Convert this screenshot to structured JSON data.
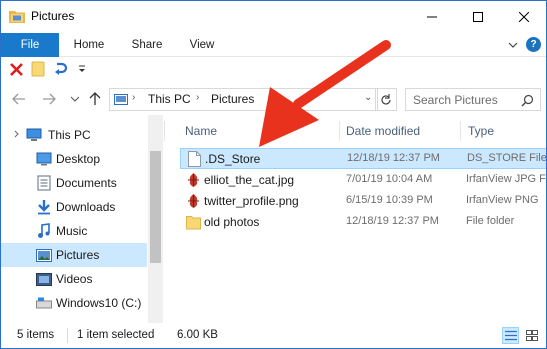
{
  "window": {
    "title": "Pictures"
  },
  "ribbon": {
    "tabs": [
      "File",
      "Home",
      "Share",
      "View"
    ],
    "accent": "#1979ca"
  },
  "address": {
    "crumbs": [
      "This PC",
      "Pictures"
    ]
  },
  "search": {
    "placeholder": "Search Pictures"
  },
  "nav": {
    "items": [
      {
        "label": "This PC",
        "icon": "computer-icon"
      },
      {
        "label": "Desktop",
        "icon": "desktop-icon"
      },
      {
        "label": "Documents",
        "icon": "documents-icon"
      },
      {
        "label": "Downloads",
        "icon": "downloads-icon"
      },
      {
        "label": "Music",
        "icon": "music-icon"
      },
      {
        "label": "Pictures",
        "icon": "pictures-icon",
        "selected": true
      },
      {
        "label": "Videos",
        "icon": "videos-icon"
      },
      {
        "label": "Windows10 (C:)",
        "icon": "drive-icon"
      }
    ]
  },
  "files": {
    "columns": [
      "Name",
      "Date modified",
      "Type"
    ],
    "rows": [
      {
        "name": ".DS_Store",
        "date": "12/18/19 12:37 PM",
        "type": "DS_STORE File",
        "icon": "blank-file-icon",
        "selected": true
      },
      {
        "name": "elliot_the_cat.jpg",
        "date": "7/01/19 10:04 AM",
        "type": "IrfanView JPG F",
        "icon": "irfanview-icon"
      },
      {
        "name": "twitter_profile.png",
        "date": "6/15/19 10:39 PM",
        "type": "IrfanView PNG",
        "icon": "irfanview-icon"
      },
      {
        "name": "old photos",
        "date": "12/18/19 12:37 PM",
        "type": "File folder",
        "icon": "folder-icon"
      }
    ]
  },
  "status": {
    "count": "5 items",
    "selection": "1 item selected",
    "size": "6.00 KB"
  },
  "colors": {
    "selection": "#cce8ff",
    "arrow": "#e8321e"
  }
}
